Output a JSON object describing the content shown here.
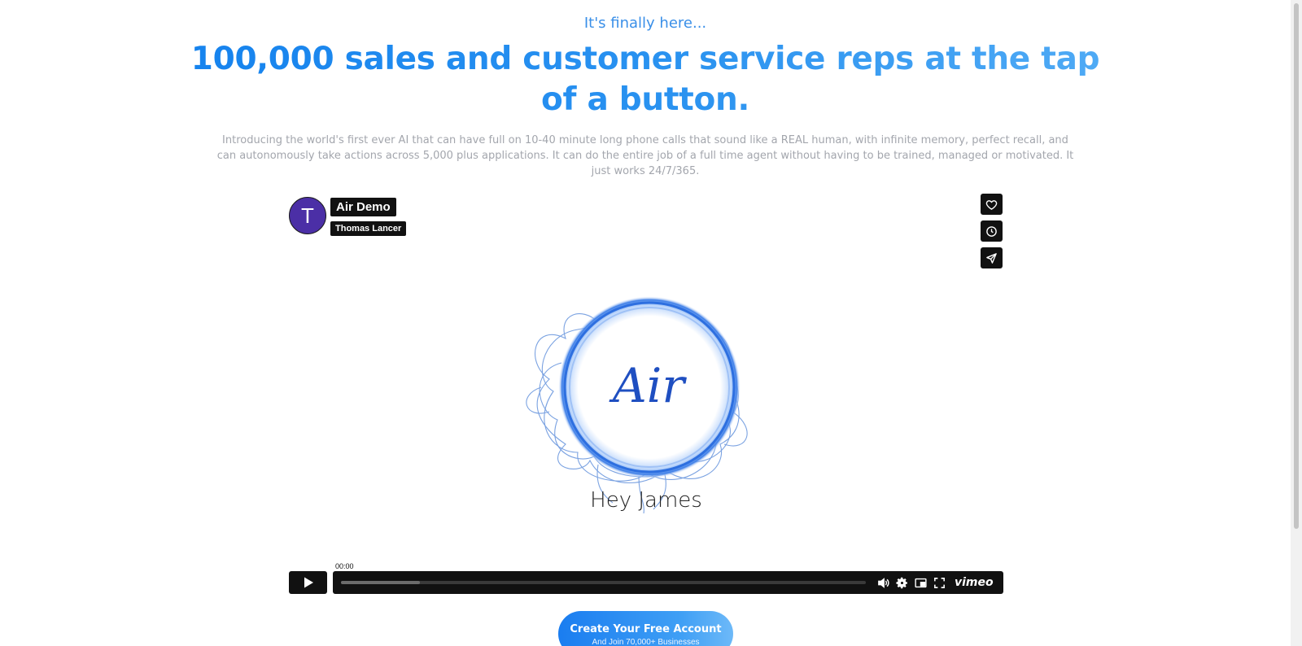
{
  "hero": {
    "eyebrow": "It's finally here...",
    "headline": "100,000 sales and customer service reps at the tap of a button.",
    "intro": "Introducing the world's first ever AI that can have full on 10-40 minute long phone calls that sound like a REAL human, with infinite memory, perfect recall, and can autonomously take actions across 5,000 plus applications. It can do the entire job of a full time agent without having to be trained, managed or motivated. It just works 24/7/365."
  },
  "video": {
    "avatar_initial": "T",
    "title": "Air Demo",
    "author": "Thomas Lancer",
    "logo_text": "Air",
    "caption": "Hey James",
    "current_time": "00:00",
    "progress": 0.15,
    "brand": "vimeo",
    "side_actions": [
      "heart-icon",
      "clock-icon",
      "send-icon"
    ]
  },
  "cta": {
    "label": "Create Your Free Account",
    "sublabel": "And Join 70,000+ Businesses"
  },
  "colors": {
    "accent": "#1a84ee",
    "player_bar": "#111111",
    "avatar": "#4b2fa6"
  }
}
